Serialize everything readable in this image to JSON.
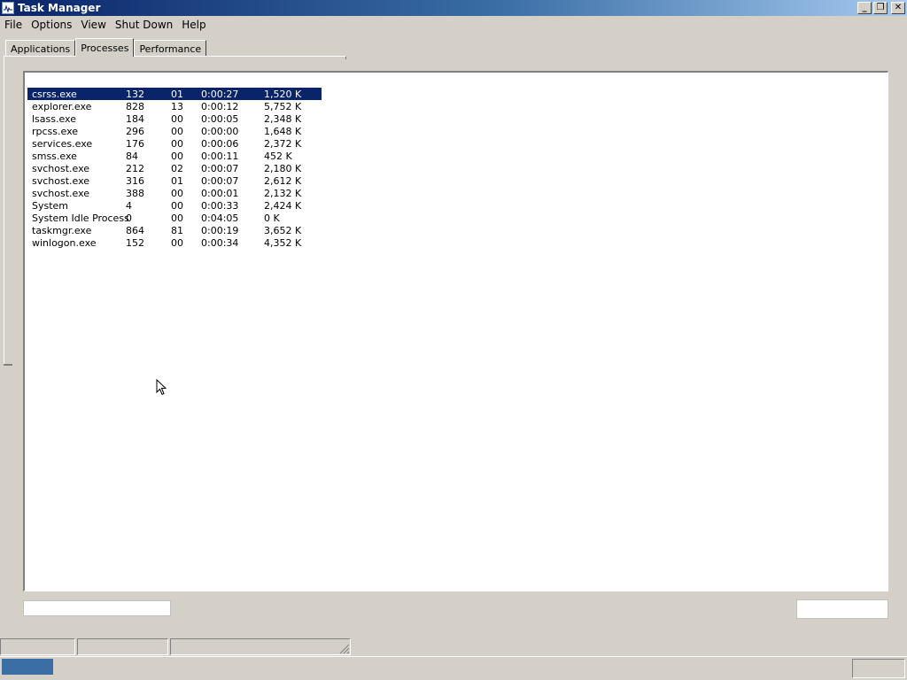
{
  "window": {
    "title": "Task Manager"
  },
  "menu": [
    "File",
    "Options",
    "View",
    "Shut Down",
    "Help"
  ],
  "tabs": [
    "Applications",
    "Processes",
    "Performance"
  ],
  "active_tab": "Processes",
  "processes": [
    {
      "name": "csrss.exe",
      "pid": "132",
      "cpu": "01",
      "cpu_time": "0:00:27",
      "mem": "1,520 K",
      "selected": true
    },
    {
      "name": "explorer.exe",
      "pid": "828",
      "cpu": "13",
      "cpu_time": "0:00:12",
      "mem": "5,752 K"
    },
    {
      "name": "lsass.exe",
      "pid": "184",
      "cpu": "00",
      "cpu_time": "0:00:05",
      "mem": "2,348 K"
    },
    {
      "name": "rpcss.exe",
      "pid": "296",
      "cpu": "00",
      "cpu_time": "0:00:00",
      "mem": "1,648 K"
    },
    {
      "name": "services.exe",
      "pid": "176",
      "cpu": "00",
      "cpu_time": "0:00:06",
      "mem": "2,372 K"
    },
    {
      "name": "smss.exe",
      "pid": "84",
      "cpu": "00",
      "cpu_time": "0:00:11",
      "mem": "452 K"
    },
    {
      "name": "svchost.exe",
      "pid": "212",
      "cpu": "02",
      "cpu_time": "0:00:07",
      "mem": "2,180 K"
    },
    {
      "name": "svchost.exe",
      "pid": "316",
      "cpu": "01",
      "cpu_time": "0:00:07",
      "mem": "2,612 K"
    },
    {
      "name": "svchost.exe",
      "pid": "388",
      "cpu": "00",
      "cpu_time": "0:00:01",
      "mem": "2,132 K"
    },
    {
      "name": "System",
      "pid": "4",
      "cpu": "00",
      "cpu_time": "0:00:33",
      "mem": "2,424 K"
    },
    {
      "name": "System Idle Process",
      "pid": "0",
      "cpu": "00",
      "cpu_time": "0:04:05",
      "mem": "0 K"
    },
    {
      "name": "taskmgr.exe",
      "pid": "864",
      "cpu": "81",
      "cpu_time": "0:00:19",
      "mem": "3,652 K"
    },
    {
      "name": "winlogon.exe",
      "pid": "152",
      "cpu": "00",
      "cpu_time": "0:00:34",
      "mem": "4,352 K"
    }
  ],
  "colors": {
    "selection": "#0a246a",
    "titlebar": "#0a246a",
    "face": "#d4d0c8"
  }
}
